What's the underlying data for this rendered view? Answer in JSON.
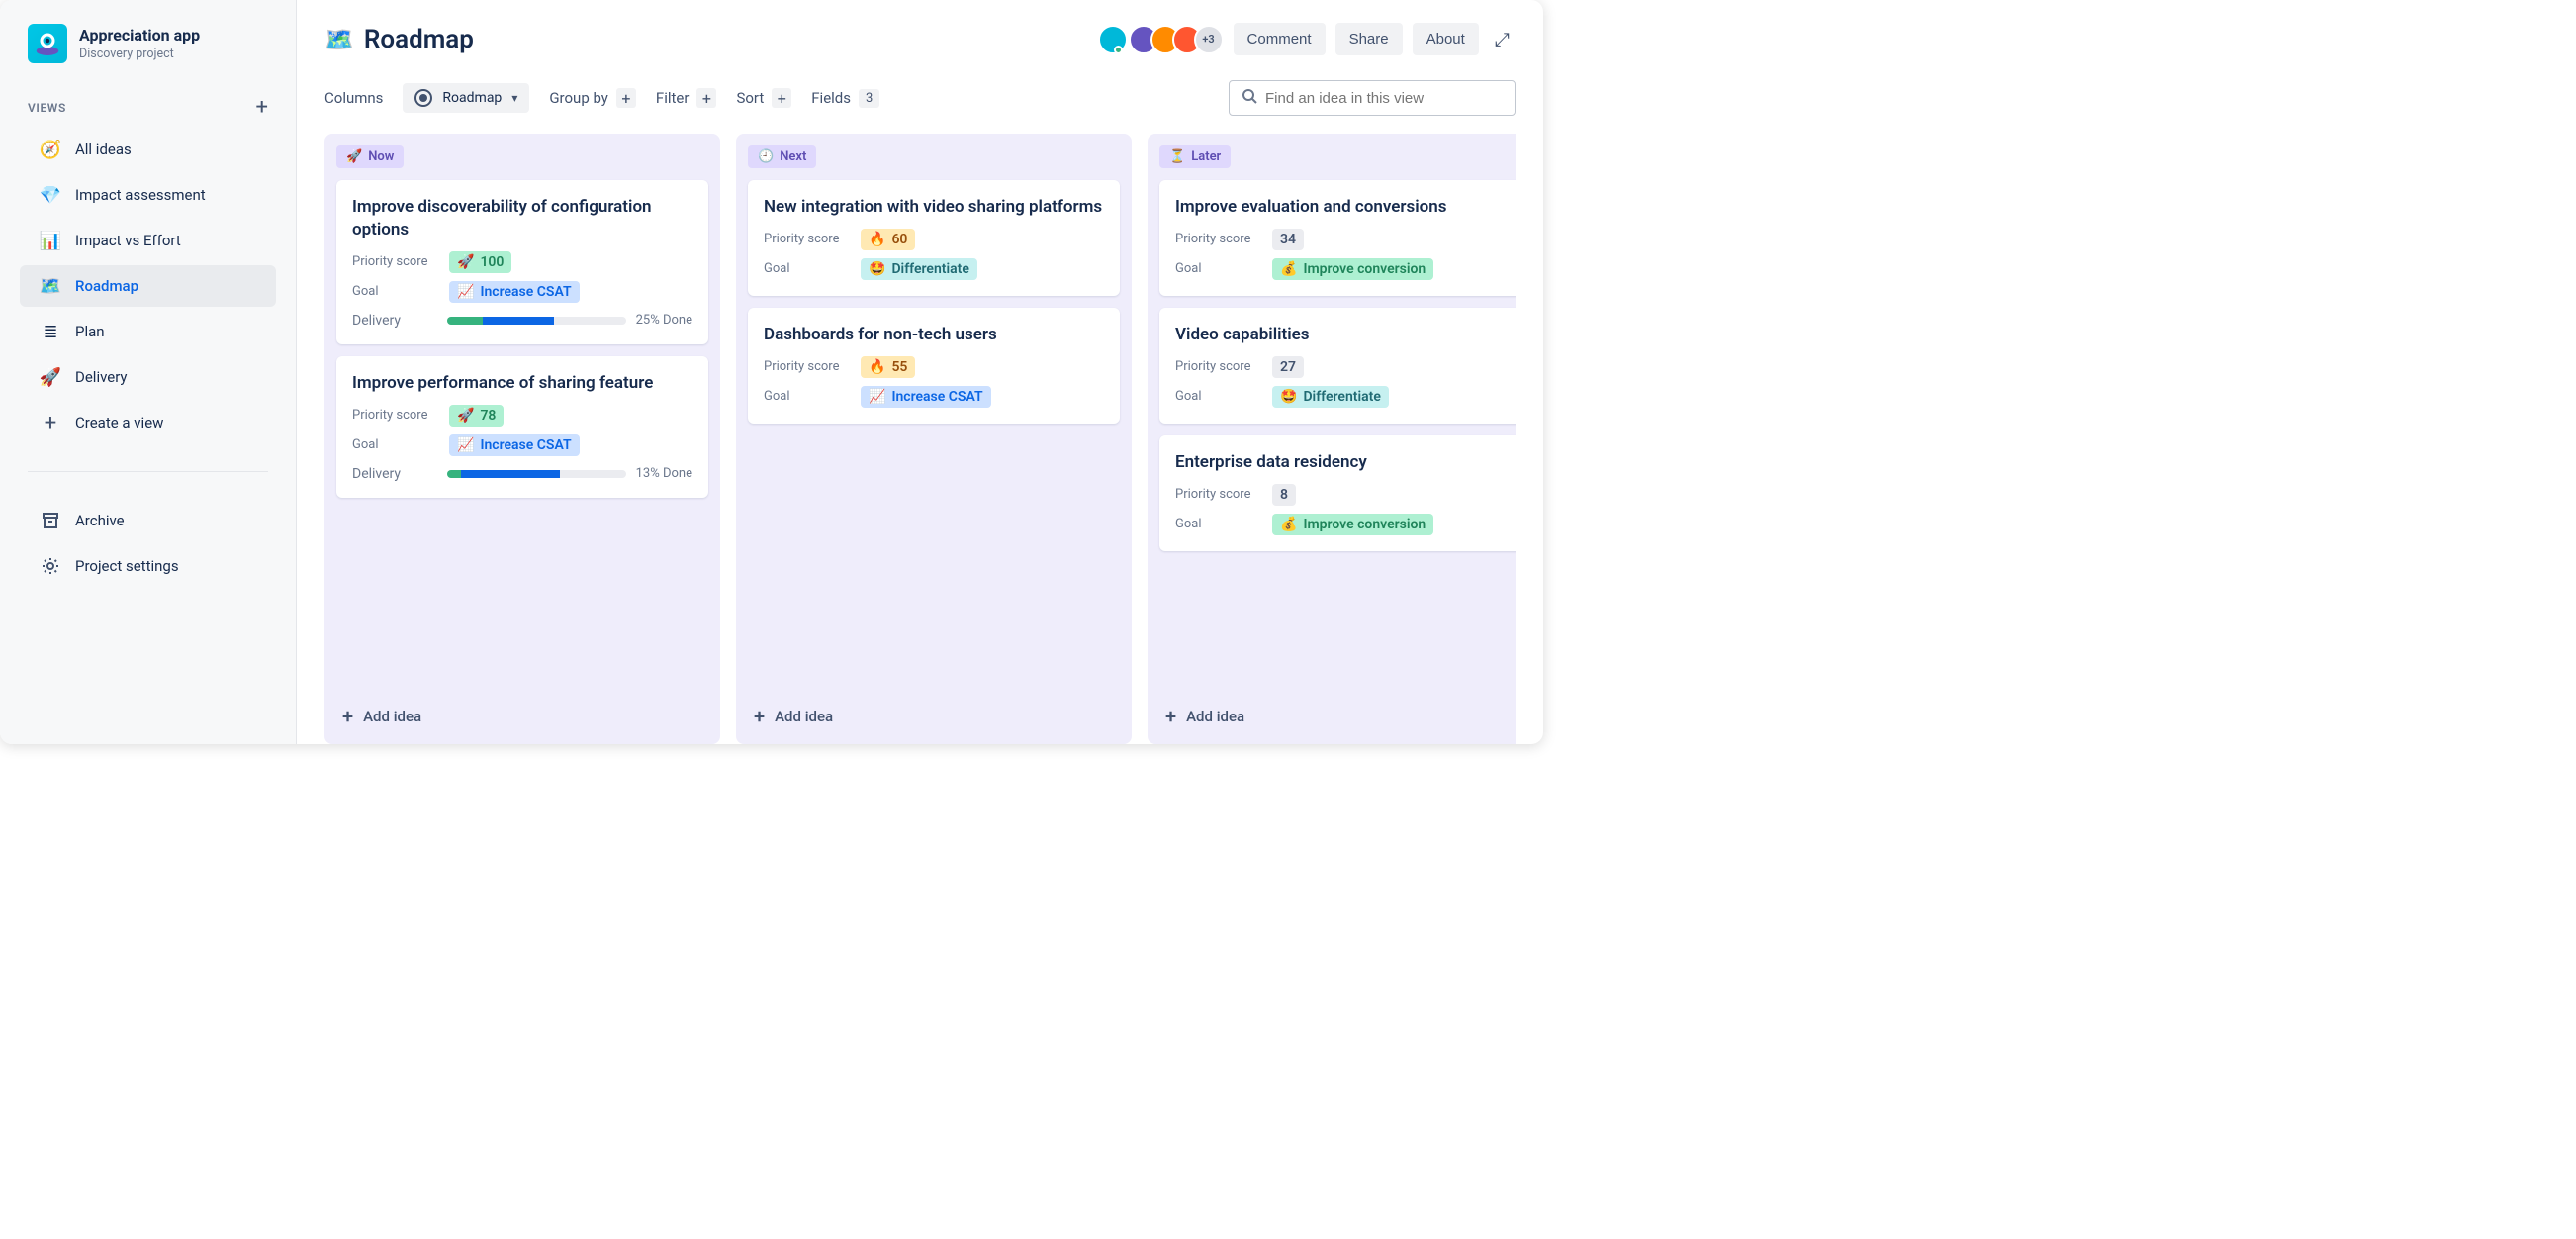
{
  "brand": {
    "title": "Appreciation app",
    "subtitle": "Discovery project"
  },
  "sidebar": {
    "views_label": "VIEWS",
    "items": [
      {
        "label": "All ideas",
        "icon": "🧭"
      },
      {
        "label": "Impact assessment",
        "icon": "💎"
      },
      {
        "label": "Impact vs Effort",
        "icon": "📊"
      },
      {
        "label": "Roadmap",
        "icon": "🗺️"
      },
      {
        "label": "Plan",
        "icon": "≣"
      },
      {
        "label": "Delivery",
        "icon": "🚀"
      }
    ],
    "create_label": "Create a view",
    "archive_label": "Archive",
    "settings_label": "Project settings"
  },
  "page": {
    "icon": "🗺️",
    "title": "Roadmap"
  },
  "toolbar": {
    "columns_label": "Columns",
    "columns_value": "Roadmap",
    "groupby_label": "Group by",
    "filter_label": "Filter",
    "sort_label": "Sort",
    "fields_label": "Fields",
    "fields_count": "3",
    "search_placeholder": "Find an idea in this view"
  },
  "topbar": {
    "comment_label": "Comment",
    "share_label": "Share",
    "about_label": "About",
    "extra_avatars": "+3"
  },
  "columns": [
    {
      "name": "Now",
      "icon": "🚀",
      "cards": [
        {
          "title": "Improve discoverability of configuration options",
          "priority_label": "Priority score",
          "priority_badge": {
            "icon": "🚀",
            "value": "100",
            "style": "green"
          },
          "goal_label": "Goal",
          "goal": {
            "icon": "📈",
            "text": "Increase CSAT",
            "style": "blue"
          },
          "delivery_label": "Delivery",
          "progress": {
            "green": 20,
            "blue": 40,
            "text": "25% Done"
          }
        },
        {
          "title": "Improve performance of sharing feature",
          "priority_label": "Priority score",
          "priority_badge": {
            "icon": "🚀",
            "value": "78",
            "style": "green"
          },
          "goal_label": "Goal",
          "goal": {
            "icon": "📈",
            "text": "Increase CSAT",
            "style": "blue"
          },
          "delivery_label": "Delivery",
          "progress": {
            "green": 8,
            "blue": 55,
            "text": "13% Done"
          }
        }
      ],
      "add_label": "Add idea"
    },
    {
      "name": "Next",
      "icon": "🕘",
      "cards": [
        {
          "title": "New integration with video sharing platforms",
          "priority_label": "Priority score",
          "priority_badge": {
            "icon": "🔥",
            "value": "60",
            "style": "yellow"
          },
          "goal_label": "Goal",
          "goal": {
            "icon": "🤩",
            "text": "Differentiate",
            "style": "teal"
          }
        },
        {
          "title": "Dashboards for non-tech users",
          "priority_label": "Priority score",
          "priority_badge": {
            "icon": "🔥",
            "value": "55",
            "style": "yellow"
          },
          "goal_label": "Goal",
          "goal": {
            "icon": "📈",
            "text": "Increase CSAT",
            "style": "blue"
          }
        }
      ],
      "add_label": "Add idea"
    },
    {
      "name": "Later",
      "icon": "⏳",
      "cards": [
        {
          "title": "Improve evaluation and conversions",
          "priority_label": "Priority score",
          "priority_badge": {
            "value": "34",
            "style": "gray"
          },
          "goal_label": "Goal",
          "goal": {
            "icon": "💰",
            "text": "Improve conversion",
            "style": "green"
          }
        },
        {
          "title": "Video capabilities",
          "priority_label": "Priority score",
          "priority_badge": {
            "value": "27",
            "style": "gray"
          },
          "goal_label": "Goal",
          "goal": {
            "icon": "🤩",
            "text": "Differentiate",
            "style": "teal"
          }
        },
        {
          "title": "Enterprise data residency",
          "priority_label": "Priority score",
          "priority_badge": {
            "value": "8",
            "style": "gray"
          },
          "goal_label": "Goal",
          "goal": {
            "icon": "💰",
            "text": "Improve conversion",
            "style": "green"
          }
        }
      ],
      "add_label": "Add idea"
    }
  ]
}
